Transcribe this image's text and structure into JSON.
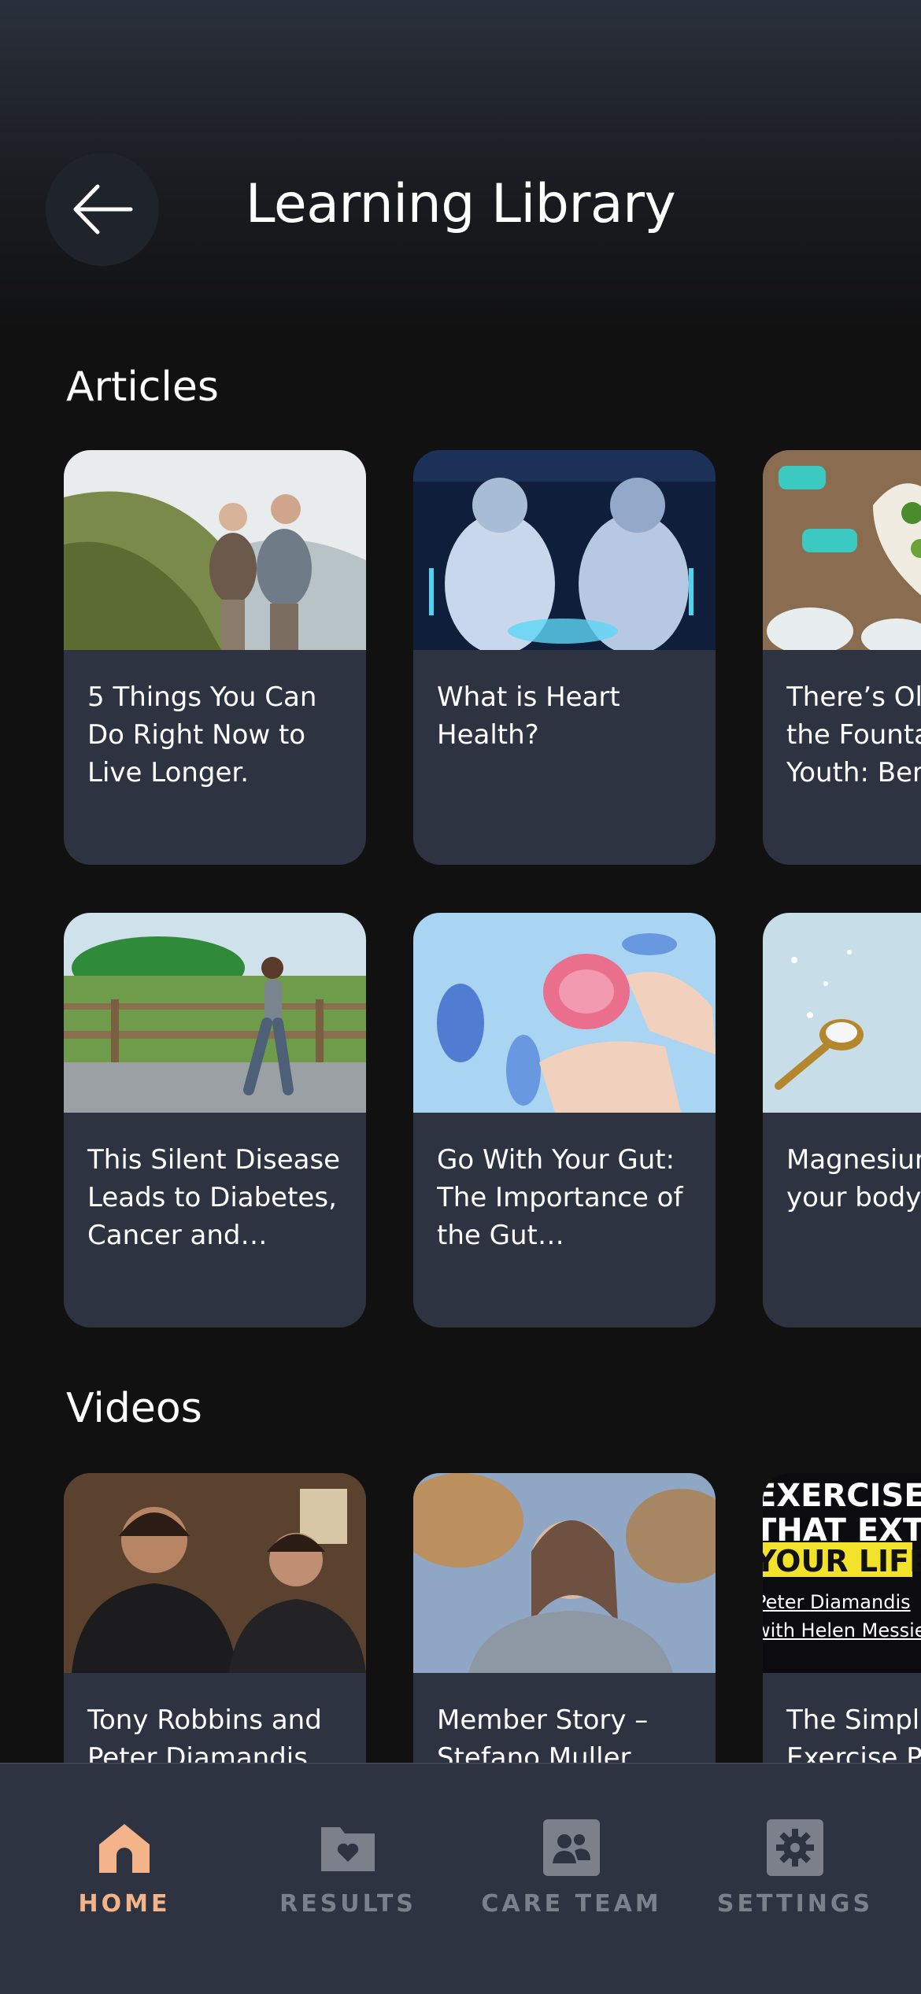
{
  "header": {
    "title": "Learning Library"
  },
  "articles": {
    "heading": "Articles",
    "row1": [
      {
        "title": "5 Things You Can Do Right Now to Live Longer.",
        "image": "couple-hiking-coast"
      },
      {
        "title": "What is Heart Health?",
        "image": "lab-scientists"
      },
      {
        "title": "There’s Olive Oil – the Fountain of Youth: Benefits",
        "image": "heart-bowl-dumbbells"
      }
    ],
    "row2": [
      {
        "title": "This Silent Disease Leads to Diabetes, Cancer and Dementia",
        "image": "woman-walking-boardwalk"
      },
      {
        "title": "Go With Your Gut: The Importance of the Gut Microbiome",
        "image": "gut-microbiome"
      },
      {
        "title": "Magnesium and your body",
        "image": "salt-spoon"
      }
    ]
  },
  "videos": {
    "heading": "Videos",
    "items": [
      {
        "title": "Tony Robbins and Peter Diamandis on",
        "image": "two-men-interview"
      },
      {
        "title": "Member Story – Stefano Muller",
        "image": "woman-outdoors"
      },
      {
        "title": "The Simple Exercise Protocol",
        "image": "exercises-thumbnail",
        "thumb_text": [
          "EXERCISES",
          "THAT EXTEND",
          "YOUR LIFE",
          "Peter Diamandis",
          "with Helen Messier"
        ]
      }
    ]
  },
  "tabbar": {
    "tabs": [
      {
        "label": "HOME",
        "icon": "home-icon",
        "active": true
      },
      {
        "label": "RESULTS",
        "icon": "folder-heart-icon",
        "active": false
      },
      {
        "label": "CARE TEAM",
        "icon": "people-icon",
        "active": false
      },
      {
        "label": "SETTINGS",
        "icon": "gear-icon",
        "active": false
      }
    ]
  },
  "colors": {
    "accent": "#f4b489",
    "card": "#2d3340",
    "background": "#111112",
    "inactive": "#7b808b"
  }
}
